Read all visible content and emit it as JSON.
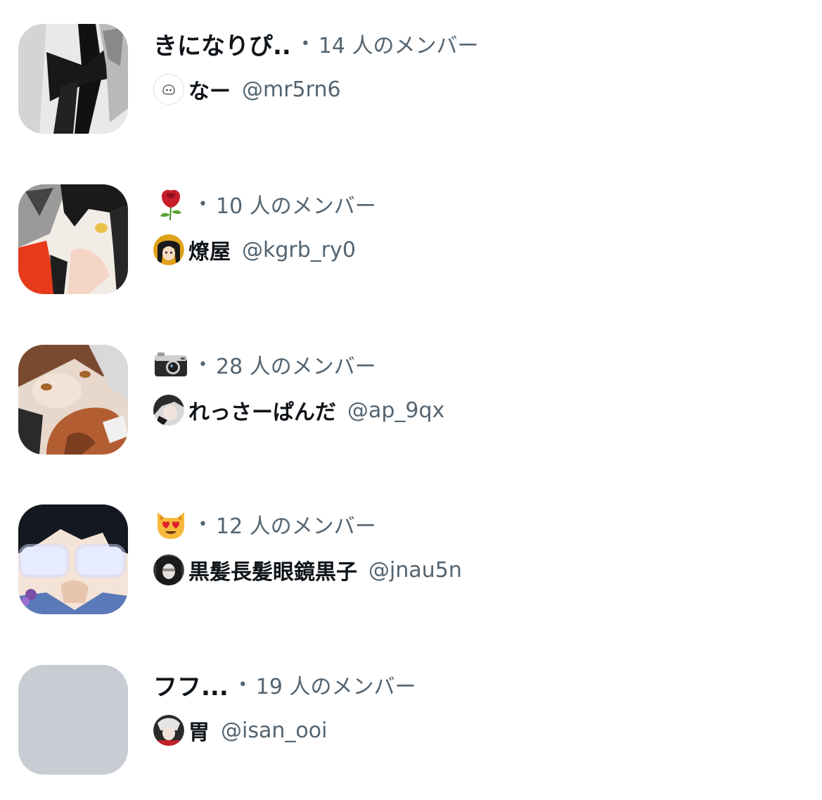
{
  "communities": [
    {
      "name": "きになりぴ..",
      "emoji": "",
      "separator": "•",
      "member_count": "14 人のメンバー",
      "creator_name": "なー",
      "creator_handle": "@mr5rn6",
      "creator_avatar_icon": "default-egg-avatar-icon",
      "avatar_colors": [
        "#e9e9e9",
        "#111111",
        "#8a8a8a"
      ]
    },
    {
      "name": "",
      "emoji": "rose-emoji",
      "separator": "•",
      "member_count": "10 人のメンバー",
      "creator_name": "燎屋",
      "creator_handle": "@kgrb_ry0",
      "creator_avatar_icon": "anime-avatar-icon",
      "avatar_colors": [
        "#f2ece6",
        "#1a1a1a",
        "#e63a1a"
      ]
    },
    {
      "name": "",
      "emoji": "camera-emoji",
      "separator": "•",
      "member_count": "28 人のメンバー",
      "creator_name": "れっさーぱんだ",
      "creator_handle": "@ap_9qx",
      "creator_avatar_icon": "anime-avatar-icon",
      "avatar_colors": [
        "#e8d8cc",
        "#7a4a30",
        "#b35d32"
      ]
    },
    {
      "name": "",
      "emoji": "heart-eyes-cat-emoji",
      "separator": "•",
      "member_count": "12 人のメンバー",
      "creator_name": "黒髪長髪眼鏡黒子",
      "creator_handle": "@jnau5n",
      "creator_avatar_icon": "anime-avatar-icon",
      "avatar_colors": [
        "#f4e4d8",
        "#141821",
        "#5a79b8"
      ]
    },
    {
      "name": "フフ...",
      "emoji": "",
      "separator": "•",
      "member_count": "19 人のメンバー",
      "creator_name": "胃",
      "creator_handle": "@isan_ooi",
      "creator_avatar_icon": "anime-avatar-icon",
      "avatar_colors": [
        "#c8cdd4"
      ]
    }
  ]
}
